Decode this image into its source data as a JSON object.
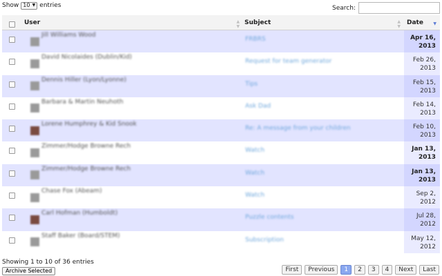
{
  "length_control": {
    "prefix": "Show",
    "value": "10",
    "suffix": "entries"
  },
  "search": {
    "label": "Search:",
    "value": "",
    "placeholder": ""
  },
  "columns": {
    "user": "User",
    "subject": "Subject",
    "date": "Date"
  },
  "rows": [
    {
      "user": "Jill Williams Wood",
      "subject": "FRBRS",
      "date_line1": "Apr 16,",
      "date_line2": "2013",
      "bold": true,
      "avatar": "gray"
    },
    {
      "user": "David Nicolaides (Dublin/Kid)",
      "subject": "Request for team generator",
      "date_line1": "Feb 26,",
      "date_line2": "2013",
      "bold": false,
      "avatar": "gray"
    },
    {
      "user": "Dennis Hiller (Lyon/Lyonne)",
      "subject": "Tips",
      "date_line1": "Feb 15,",
      "date_line2": "2013",
      "bold": false,
      "avatar": "gray"
    },
    {
      "user": "Barbara & Martin Neuhoth",
      "subject": "Ask Dad",
      "date_line1": "Feb 14,",
      "date_line2": "2013",
      "bold": false,
      "avatar": "gray"
    },
    {
      "user": "Lorene Humphrey & Kid Snook",
      "subject": "Re: A message from your children",
      "date_line1": "Feb 10,",
      "date_line2": "2013",
      "bold": false,
      "avatar": "color"
    },
    {
      "user": "Zimmer/Hodge Browne Rech",
      "subject": "Watch",
      "date_line1": "Jan 13,",
      "date_line2": "2013",
      "bold": true,
      "avatar": "gray"
    },
    {
      "user": "Zimmer/Hodge Browne Rech",
      "subject": "Watch",
      "date_line1": "Jan 13,",
      "date_line2": "2013",
      "bold": true,
      "avatar": "gray"
    },
    {
      "user": "Chase Fox (Abeam)",
      "subject": "Watch",
      "date_line1": "Sep 2,",
      "date_line2": "2012",
      "bold": false,
      "avatar": "gray"
    },
    {
      "user": "Carl Hofman (Humboldt)",
      "subject": "Puzzle contents",
      "date_line1": "Jul 28,",
      "date_line2": "2012",
      "bold": false,
      "avatar": "color"
    },
    {
      "user": "Staff Baker (Board/STEM)",
      "subject": "Subscription",
      "date_line1": "May 12,",
      "date_line2": "2012",
      "bold": false,
      "avatar": "gray"
    }
  ],
  "info": "Showing 1 to 10 of 36 entries",
  "archive_label": "Archive Selected",
  "pagination": {
    "first": "First",
    "previous": "Previous",
    "pages": [
      "1",
      "2",
      "3",
      "4"
    ],
    "current": "1",
    "next": "Next",
    "last": "Last"
  },
  "icons": {
    "select": "dropdown-arrow-icon",
    "sort": "sort-both-icon",
    "sort_active": "sort-desc-icon"
  },
  "colors": {
    "row_odd": "#e2e4ff",
    "row_even": "#ffffff",
    "link": "#6fa7dc",
    "page_current": "#8aa8f0"
  }
}
